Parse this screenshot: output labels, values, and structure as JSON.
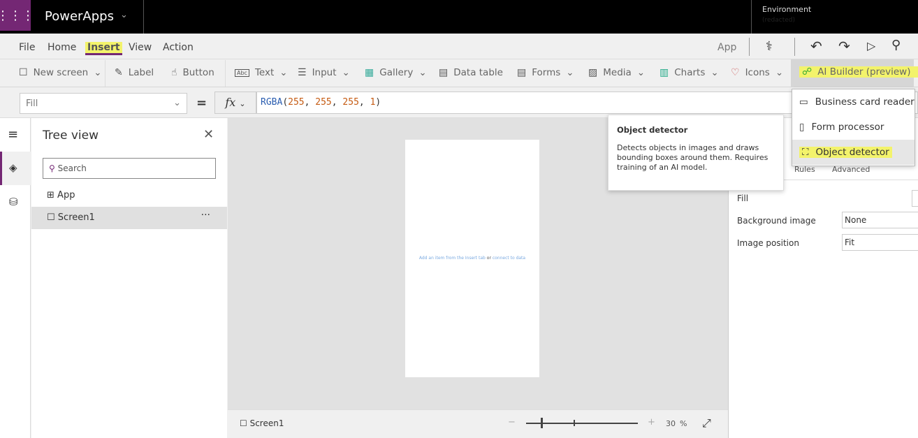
{
  "header": {
    "app_name": "PowerApps",
    "environment_label": "Environment",
    "environment_value": "(redacted)"
  },
  "menu": {
    "items": [
      "File",
      "Home",
      "Insert",
      "View",
      "Action"
    ],
    "active": "Insert",
    "app_label": "App"
  },
  "toolbar": {
    "new_screen": "New screen",
    "label": "Label",
    "button": "Button",
    "text": "Text",
    "input": "Input",
    "gallery": "Gallery",
    "data_table": "Data table",
    "forms": "Forms",
    "media": "Media",
    "charts": "Charts",
    "icons": "Icons",
    "ai_builder": "AI Builder (preview)"
  },
  "formula_bar": {
    "property": "Fill",
    "equals": "=",
    "fx": "fx",
    "func": "RGBA",
    "args": [
      "255",
      "255",
      "255",
      "1"
    ]
  },
  "tree_view": {
    "title": "Tree view",
    "search_placeholder": "Search",
    "items": [
      {
        "label": "App"
      },
      {
        "label": "Screen1",
        "more": "···"
      }
    ]
  },
  "canvas": {
    "hint_part1": "Add an item from the Insert tab",
    "hint_or": " or ",
    "hint_part2": "connect to data"
  },
  "bottom_bar": {
    "screen": "Screen1",
    "zoom": "30",
    "zoom_unit": "%",
    "zoom_minus": "−",
    "zoom_plus": "+",
    "zoom_percent": 30
  },
  "properties": {
    "tabs": [
      "Rules",
      "Advanced"
    ],
    "fill_label": "Fill",
    "bg_image_label": "Background image",
    "bg_image_value": "None",
    "image_pos_label": "Image position",
    "image_pos_value": "Fit"
  },
  "ai_dropdown": {
    "items": [
      "Business card reader",
      "Form processor",
      "Object detector"
    ],
    "selected": "Object detector"
  },
  "tooltip": {
    "title": "Object detector",
    "body": "Detects objects in images and draws bounding boxes around them. Requires training of an AI model."
  },
  "colors": {
    "brand": "#742774",
    "highlight": "#f3f36b",
    "formula_func": "#2a5db0",
    "formula_num": "#c55a11"
  }
}
